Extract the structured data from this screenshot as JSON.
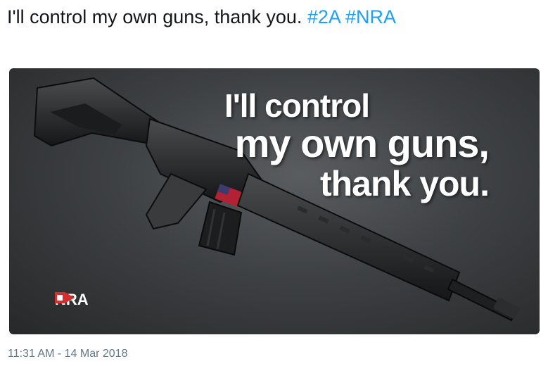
{
  "tweet": {
    "text": "I'll control my own guns, thank you.",
    "hashtags": [
      "#2A",
      "#NRA"
    ],
    "timestamp": "11:31 AM - 14 Mar 2018"
  },
  "media": {
    "headline_line1": "I'll control",
    "headline_line2": "my own guns,",
    "headline_line3": "thank you.",
    "logo_text": "NRA",
    "logo_color": "#d32f2f"
  },
  "colors": {
    "hashtag": "#1da1f2",
    "text": "#14171a",
    "meta": "#657786"
  }
}
